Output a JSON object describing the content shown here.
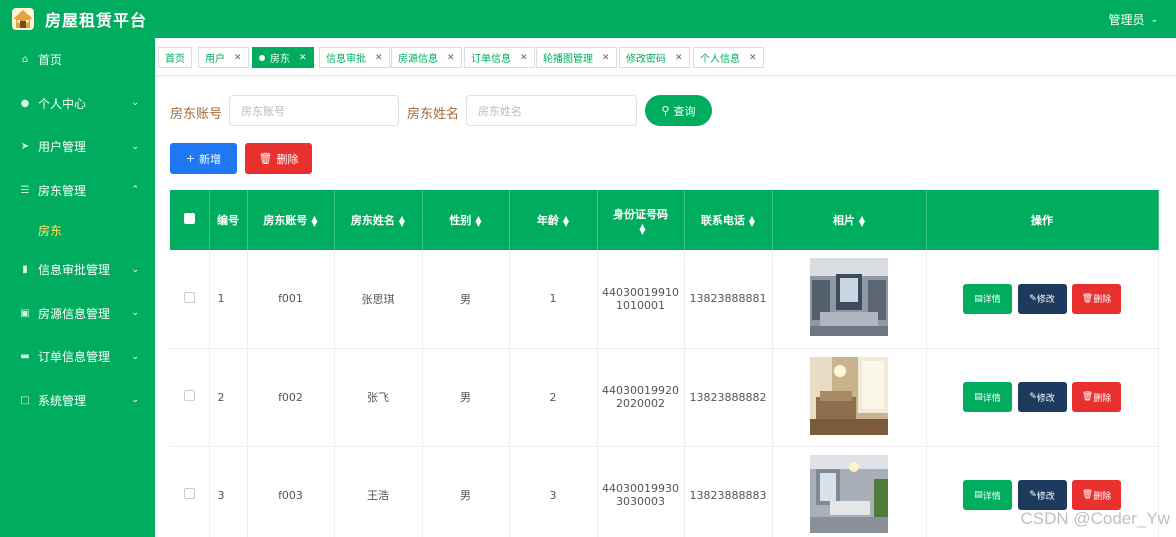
{
  "header": {
    "title": "房屋租赁平台",
    "user": "管理员"
  },
  "sidebar": {
    "items": [
      {
        "label": "首页",
        "icon": "home-icon",
        "has_arrow": false
      },
      {
        "label": "个人中心",
        "icon": "user-icon",
        "has_arrow": true
      },
      {
        "label": "用户管理",
        "icon": "send-icon",
        "has_arrow": true
      },
      {
        "label": "房东管理",
        "icon": "menu-icon",
        "has_arrow": true,
        "expanded": true
      },
      {
        "label": "信息审批管理",
        "icon": "document-icon",
        "has_arrow": true
      },
      {
        "label": "房源信息管理",
        "icon": "film-icon",
        "has_arrow": true
      },
      {
        "label": "订单信息管理",
        "icon": "chat-icon",
        "has_arrow": true
      },
      {
        "label": "系统管理",
        "icon": "crop-icon",
        "has_arrow": true
      }
    ],
    "sub_item": "房东"
  },
  "tabs": [
    {
      "label": "首页",
      "active": false,
      "closable": false
    },
    {
      "label": "用户",
      "active": false,
      "closable": true
    },
    {
      "label": "房东",
      "active": true,
      "closable": true
    },
    {
      "label": "信息审批",
      "active": false,
      "closable": true
    },
    {
      "label": "房源信息",
      "active": false,
      "closable": true
    },
    {
      "label": "订单信息",
      "active": false,
      "closable": true
    },
    {
      "label": "轮播图管理",
      "active": false,
      "closable": true
    },
    {
      "label": "修改密码",
      "active": false,
      "closable": true
    },
    {
      "label": "个人信息",
      "active": false,
      "closable": true
    }
  ],
  "search": {
    "account_label": "房东账号",
    "account_placeholder": "房东账号",
    "name_label": "房东姓名",
    "name_placeholder": "房东姓名",
    "query_button": "查询"
  },
  "actions": {
    "add": "新增",
    "delete": "删除"
  },
  "table": {
    "columns": [
      "编号",
      "房东账号",
      "房东姓名",
      "性别",
      "年龄",
      "身份证号码",
      "联系电话",
      "相片",
      "操作"
    ],
    "rows": [
      {
        "no": "1",
        "account": "f001",
        "name": "张思琪",
        "gender": "男",
        "age": "1",
        "id_line1": "44030019910",
        "id_line2": "1010001",
        "phone": "13823888881"
      },
      {
        "no": "2",
        "account": "f002",
        "name": "张飞",
        "gender": "男",
        "age": "2",
        "id_line1": "44030019920",
        "id_line2": "2020002",
        "phone": "13823888882"
      },
      {
        "no": "3",
        "account": "f003",
        "name": "王浩",
        "gender": "男",
        "age": "3",
        "id_line1": "44030019930",
        "id_line2": "3030003",
        "phone": "13823888883"
      }
    ],
    "row_actions": {
      "detail": "详情",
      "edit": "修改",
      "remove": "删除"
    }
  },
  "watermark": "CSDN @Coder_Yw",
  "colors": {
    "primary": "#00ad5f",
    "blue": "#1f77f3",
    "red": "#e8302f",
    "navy": "#1e3a5f"
  }
}
